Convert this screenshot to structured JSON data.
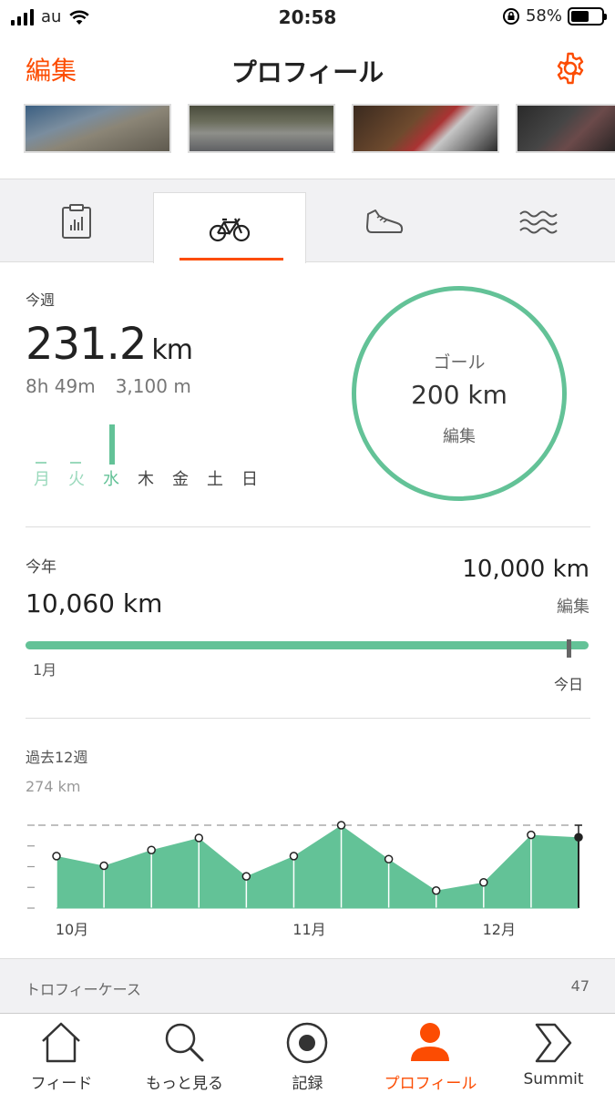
{
  "status_bar": {
    "carrier": "au",
    "time": "20:58",
    "battery": "58%",
    "battery_level": 0.58
  },
  "nav": {
    "edit_label": "編集",
    "title": "プロフィール",
    "settings_icon": "gear-icon"
  },
  "photos": [
    "photo-lakeside",
    "photo-park-road",
    "photo-bike-closeup",
    "photo-bike-parked"
  ],
  "sport_tabs": [
    {
      "name": "summary",
      "icon": "clipboard-icon",
      "active": false
    },
    {
      "name": "ride",
      "icon": "bicycle-icon",
      "active": true
    },
    {
      "name": "run",
      "icon": "shoe-icon",
      "active": false
    },
    {
      "name": "swim",
      "icon": "waves-icon",
      "active": false
    }
  ],
  "weekly": {
    "label": "今週",
    "distance": "231.2",
    "unit": "km",
    "time": "8h 49m",
    "elevation": "3,100 m",
    "days": [
      {
        "label": "月",
        "value": 0,
        "done": true
      },
      {
        "label": "火",
        "value": 0,
        "done": true
      },
      {
        "label": "水",
        "value": 231.2,
        "done": true
      },
      {
        "label": "木",
        "value": 0,
        "done": false
      },
      {
        "label": "金",
        "value": 0,
        "done": false
      },
      {
        "label": "土",
        "value": 0,
        "done": false
      },
      {
        "label": "日",
        "value": 0,
        "done": false
      }
    ],
    "goal": {
      "label": "ゴール",
      "value": "200 km",
      "edit": "編集"
    }
  },
  "yearly": {
    "label": "今年",
    "distance": "10,060 km",
    "goal": "10,000 km",
    "edit": "編集",
    "progress": 1.0,
    "start_label": "1月",
    "today_label": "今日"
  },
  "last12": {
    "label": "過去12週",
    "max_label": "274 km",
    "max_value": 274,
    "month_labels": [
      {
        "text": "10月",
        "week": 0
      },
      {
        "text": "11月",
        "week": 5
      },
      {
        "text": "12月",
        "week": 9
      }
    ]
  },
  "chart_data": {
    "type": "area",
    "title": "過去12週",
    "x": [
      1,
      2,
      3,
      4,
      5,
      6,
      7,
      8,
      9,
      10,
      11,
      12
    ],
    "values": [
      172,
      140,
      192,
      232,
      105,
      172,
      274,
      162,
      58,
      85,
      242,
      234
    ],
    "ylim": [
      0,
      274
    ],
    "xlabel": "",
    "ylabel": "",
    "tick_labels": [
      "10月",
      "11月",
      "12月"
    ],
    "grid": false,
    "color": "#63c297"
  },
  "trophy": {
    "label": "トロフィーケース",
    "count": "47"
  },
  "tabbar": [
    {
      "label": "フィード",
      "icon": "home-icon",
      "active": false
    },
    {
      "label": "もっと見る",
      "icon": "search-icon",
      "active": false
    },
    {
      "label": "記録",
      "icon": "record-icon",
      "active": false
    },
    {
      "label": "プロフィール",
      "icon": "profile-icon",
      "active": true
    },
    {
      "label": "Summit",
      "icon": "summit-icon",
      "active": false
    }
  ],
  "colors": {
    "accent": "#fc4c02",
    "green": "#63c297",
    "bg_gray": "#f1f1f3"
  }
}
